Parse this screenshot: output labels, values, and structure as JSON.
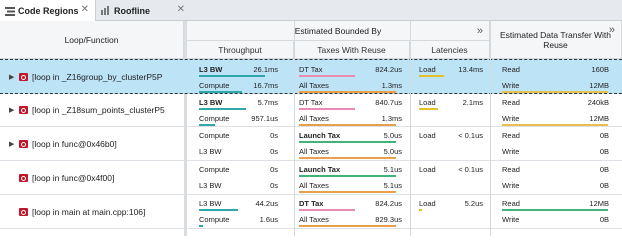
{
  "tabs": [
    {
      "label": "Code Regions",
      "active": true
    },
    {
      "label": "Roofline",
      "active": false
    }
  ],
  "headers": {
    "loop_function": "Loop/Function",
    "estimated_bounded_by": "Estimated Bounded By",
    "throughput": "Throughput",
    "taxes_with_reuse": "Taxes With Reuse",
    "latencies": "Latencies",
    "estimated_data_transfer": "Estimated Data Transfer With Reuse"
  },
  "colors": {
    "l3_bw_bar": "#2ea8a8",
    "compute_bar": "#2ea8a8",
    "dt_tax_bar": "#e98bb4",
    "all_taxes_bar": "#e8a04a",
    "launch_tax_bar": "#3fb37a",
    "load_bar": "#e6c02a",
    "read_bar": "#3fb37a",
    "write_bar": "#e8c050",
    "loop_icon": "#c0172a",
    "selection": "#bde3f7"
  },
  "rows": [
    {
      "name": "[loop in _Z16group_by_clusterP5P",
      "selected": true,
      "expandable": true,
      "t1": {
        "label": "L3 BW",
        "value": "26.1ms",
        "bold": true,
        "fill": 0.85
      },
      "t2": {
        "label": "Compute",
        "value": "16.7ms",
        "bold": false,
        "fill": 0.55
      },
      "x1": {
        "label": "DT Tax",
        "value": "824.2us",
        "bold": false,
        "fill": 0.55,
        "kind": "dt"
      },
      "x2": {
        "label": "All Taxes",
        "value": "1.3ms",
        "bold": false,
        "fill": 0.95,
        "kind": "all"
      },
      "lat": {
        "label": "Load",
        "value": "13.4ms",
        "fill": 0.4
      },
      "d1": {
        "label": "Read",
        "value": "160B",
        "fill": 0.0
      },
      "d2": {
        "label": "Write",
        "value": "12MB",
        "fill": 1.0
      }
    },
    {
      "name": "[loop in _Z18sum_points_clusterP5",
      "selected": false,
      "expandable": true,
      "t1": {
        "label": "L3 BW",
        "value": "5.7ms",
        "bold": true,
        "fill": 0.6
      },
      "t2": {
        "label": "Compute",
        "value": "957.1us",
        "bold": false,
        "fill": 0.2
      },
      "x1": {
        "label": "DT Tax",
        "value": "840.7us",
        "bold": false,
        "fill": 0.55,
        "kind": "dt"
      },
      "x2": {
        "label": "All Taxes",
        "value": "1.3ms",
        "bold": false,
        "fill": 0.95,
        "kind": "all"
      },
      "lat": {
        "label": "Load",
        "value": "2.1ms",
        "fill": 0.3
      },
      "d1": {
        "label": "Read",
        "value": "240kB",
        "fill": 0.0
      },
      "d2": {
        "label": "Write",
        "value": "12MB",
        "fill": 1.0
      }
    },
    {
      "name": "[loop in func@0x46b0]",
      "selected": false,
      "expandable": true,
      "t1": {
        "label": "Compute",
        "value": "0s",
        "bold": false,
        "fill": 0.0
      },
      "t2": {
        "label": "L3 BW",
        "value": "0s",
        "bold": false,
        "fill": 0.0
      },
      "x1": {
        "label": "Launch Tax",
        "value": "5.0us",
        "bold": true,
        "fill": 0.95,
        "kind": "launch"
      },
      "x2": {
        "label": "All Taxes",
        "value": "5.0us",
        "bold": false,
        "fill": 0.95,
        "kind": "all"
      },
      "lat": {
        "label": "Load",
        "value": "< 0.1us",
        "fill": 0.0
      },
      "d1": {
        "label": "Read",
        "value": "0B",
        "fill": 0.0
      },
      "d2": {
        "label": "Write",
        "value": "0B",
        "fill": 0.0
      }
    },
    {
      "name": "[loop in func@0x4f00]",
      "selected": false,
      "expandable": false,
      "t1": {
        "label": "Compute",
        "value": "0s",
        "bold": false,
        "fill": 0.0
      },
      "t2": {
        "label": "L3 BW",
        "value": "0s",
        "bold": false,
        "fill": 0.0
      },
      "x1": {
        "label": "Launch Tax",
        "value": "5.1us",
        "bold": true,
        "fill": 0.95,
        "kind": "launch"
      },
      "x2": {
        "label": "All Taxes",
        "value": "5.1us",
        "bold": false,
        "fill": 0.95,
        "kind": "all"
      },
      "lat": {
        "label": "Load",
        "value": "< 0.1us",
        "fill": 0.0
      },
      "d1": {
        "label": "Read",
        "value": "0B",
        "fill": 0.0
      },
      "d2": {
        "label": "Write",
        "value": "0B",
        "fill": 0.0
      }
    },
    {
      "name": "[loop in main at main.cpp:106]",
      "selected": false,
      "expandable": false,
      "t1": {
        "label": "L3 BW",
        "value": "44.2us",
        "bold": false,
        "fill": 0.5
      },
      "t2": {
        "label": "Compute",
        "value": "1.6us",
        "bold": false,
        "fill": 0.05
      },
      "x1": {
        "label": "DT Tax",
        "value": "824.2us",
        "bold": true,
        "fill": 0.55,
        "kind": "dt"
      },
      "x2": {
        "label": "All Taxes",
        "value": "829.3us",
        "bold": false,
        "fill": 0.95,
        "kind": "all"
      },
      "lat": {
        "label": "Load",
        "value": "5.2us",
        "fill": 0.05
      },
      "d1": {
        "label": "Read",
        "value": "12MB",
        "fill": 1.0
      },
      "d2": {
        "label": "Write",
        "value": "0B",
        "fill": 0.0
      }
    }
  ]
}
